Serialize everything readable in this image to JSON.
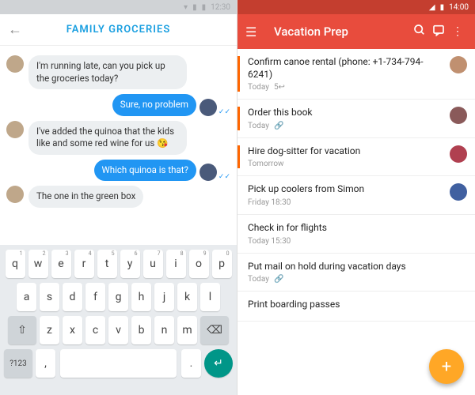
{
  "left": {
    "status_time": "12:30",
    "header": {
      "title": "FAMILY GROCERIES"
    },
    "messages": [
      {
        "dir": "in",
        "text": "I'm running late, can you pick up the groceries today?"
      },
      {
        "dir": "out",
        "text": "Sure, no problem"
      },
      {
        "dir": "in",
        "text": "I've added the quinoa that the kids like and some red wine for us 😘"
      },
      {
        "dir": "out",
        "text": "Which quinoa is that?"
      },
      {
        "dir": "in",
        "text": "The one in the green box"
      }
    ],
    "keyboard": {
      "row1": [
        "q",
        "w",
        "e",
        "r",
        "t",
        "y",
        "u",
        "i",
        "o",
        "p"
      ],
      "nums": [
        "1",
        "2",
        "3",
        "4",
        "5",
        "6",
        "7",
        "8",
        "9",
        "0"
      ],
      "row2": [
        "a",
        "s",
        "d",
        "f",
        "g",
        "h",
        "j",
        "k",
        "l"
      ],
      "row3": [
        "z",
        "x",
        "c",
        "v",
        "b",
        "n",
        "m"
      ],
      "shift": "⇧",
      "backspace": "⌫",
      "sym": "?123",
      "comma": ",",
      "period": ".",
      "enter": "↵"
    }
  },
  "right": {
    "status_time": "14:00",
    "header": {
      "title": "Vacation Prep"
    },
    "tasks": [
      {
        "title": "Confirm canoe rental (phone: +1-734-794-6241)",
        "meta": "Today",
        "extra": "5↩",
        "priority": true,
        "avatar": "#c09070"
      },
      {
        "title": "Order this book",
        "meta": "Today",
        "attach": true,
        "priority": true,
        "avatar": "#8a5a5a"
      },
      {
        "title": "Hire dog-sitter for vacation",
        "meta": "Tomorrow",
        "priority": true,
        "avatar": "#b04050"
      },
      {
        "title": "Pick up coolers from Simon",
        "meta": "Friday 18:30",
        "priority": false,
        "avatar": "#4060a0"
      },
      {
        "title": "Check in for flights",
        "meta": "Today 15:30",
        "priority": false
      },
      {
        "title": "Put mail on hold during vacation days",
        "meta": "Today",
        "attach": true,
        "priority": false
      },
      {
        "title": "Print boarding passes",
        "meta": "",
        "priority": false
      }
    ],
    "fab": "+"
  }
}
